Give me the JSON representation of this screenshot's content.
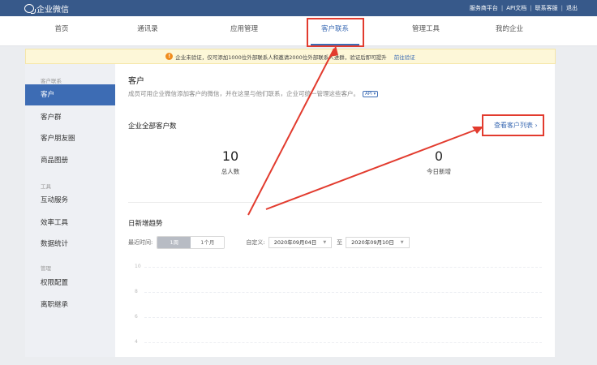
{
  "topbar": {
    "brand": "企业微信",
    "links": [
      "服务商平台",
      "API文档",
      "联系客服",
      "退出"
    ]
  },
  "nav": {
    "items": [
      "首页",
      "通讯录",
      "应用管理",
      "客户联系",
      "管理工具",
      "我的企业"
    ],
    "active": "客户联系"
  },
  "notice": {
    "text": "企业未验证，仅可添加1000位外部联系人和邀请2000位外部联系人进群，验证后即可提升",
    "link": "前往验证"
  },
  "sidebar": {
    "group1": "客户联系",
    "group1_items": [
      "客户",
      "客户群",
      "客户朋友圈",
      "商品图册"
    ],
    "group2": "工具",
    "group2_items": [
      "互动服务",
      "效率工具",
      "数据统计"
    ],
    "group3": "管理",
    "group3_items": [
      "权限配置",
      "离职继承"
    ],
    "active": "客户"
  },
  "main": {
    "title": "客户",
    "description": "成员可用企业微信添加客户的微信，并在这里与他们联系，企业可统一管理这些客户。",
    "api_badge": "API",
    "total_section": "企业全部客户数",
    "view_list_link": "查看客户列表",
    "total_count": "10",
    "total_label": "总人数",
    "new_today": "0",
    "new_today_label": "今日新增",
    "trend_title": "日新增趋势",
    "filter": {
      "recent_label": "最近时间:",
      "seg_week": "1周",
      "seg_month": "1个月",
      "custom_label": "自定义:",
      "start_date": "2020年09月04日",
      "to_label": "至",
      "end_date": "2020年09月10日"
    },
    "y_ticks": [
      "10",
      "8",
      "6",
      "4"
    ]
  },
  "colors": {
    "topbar": "#37598a",
    "accent": "#3d6cb4",
    "annotation": "#e23b2e"
  }
}
